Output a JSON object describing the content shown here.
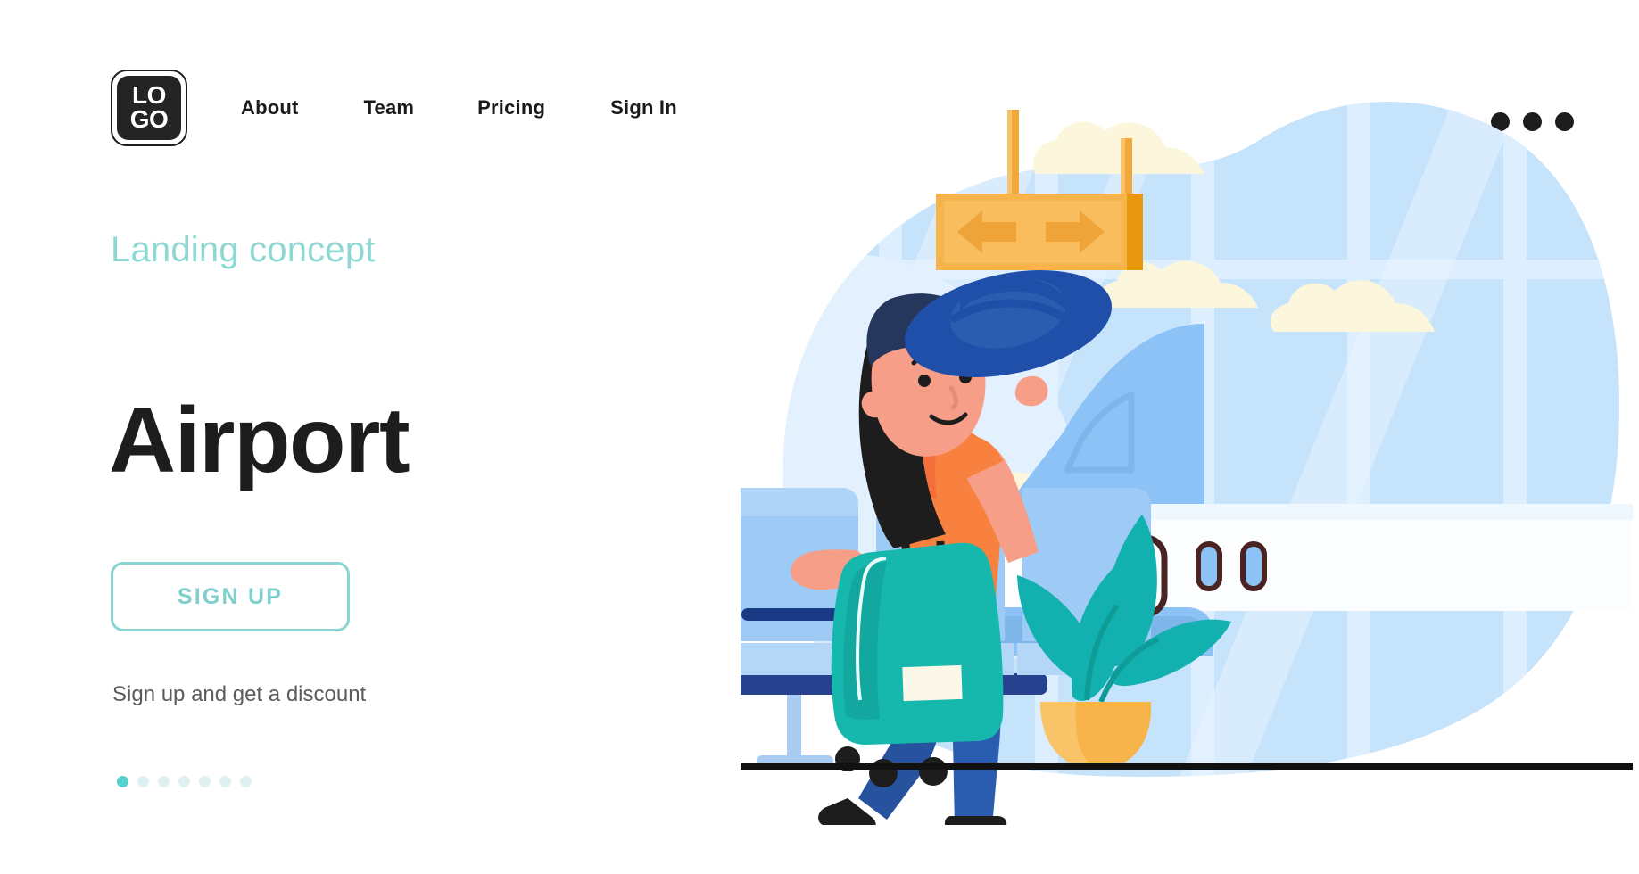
{
  "nav": {
    "logo_line1": "LO",
    "logo_line2": "GO",
    "links": [
      {
        "label": "About"
      },
      {
        "label": "Team"
      },
      {
        "label": "Pricing"
      },
      {
        "label": "Sign In"
      }
    ],
    "menu_icon": "more-horizontal-icon"
  },
  "hero": {
    "eyebrow": "Landing concept",
    "title": "Airport",
    "cta_label": "SIGN UP",
    "subtext": "Sign up and get a discount",
    "dots_total": 7,
    "dots_active_index": 0
  },
  "illustration": {
    "name": "airport-traveler-illustration",
    "scene_items": [
      "background-blob",
      "terminal-windows",
      "clouds",
      "hanging-direction-sign",
      "airplane",
      "airport-seats",
      "woman-with-hat",
      "rolling-suitcase",
      "potted-plant",
      "floor-line"
    ],
    "sign_arrows": [
      "arrow-left",
      "arrow-right"
    ]
  },
  "colors": {
    "accent_teal": "#8ed8d4",
    "accent_teal_strong": "#57cfcb",
    "ink": "#1d1d1d",
    "muted_text": "#5c5c5c",
    "blob_blue": "#c5e2fb",
    "sign_orange": "#f7b44a",
    "suitcase_teal": "#16b8ae",
    "shirt_orange": "#f8813f",
    "jeans_blue": "#2a5db0",
    "hat_navy": "#1f4fa8",
    "cloud_cream": "#fcf6dc"
  }
}
